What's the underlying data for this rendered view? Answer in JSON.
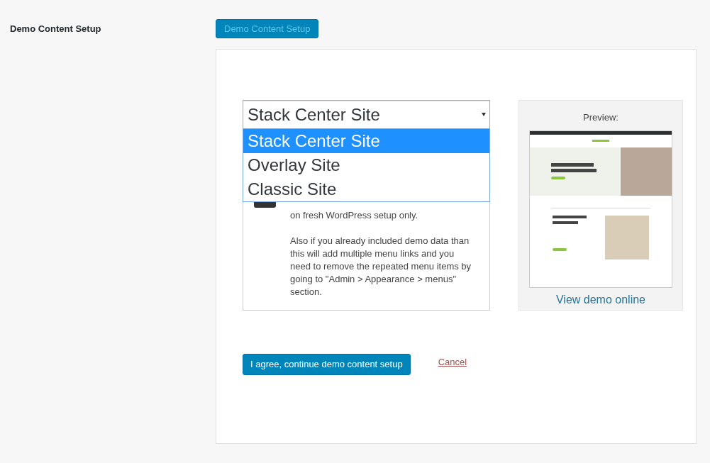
{
  "setting_label": "Demo Content Setup",
  "toggle_button": "Demo Content Setup",
  "site_select": {
    "value": "Stack Center Site",
    "expanded": true,
    "options": [
      {
        "label": "Stack Center Site",
        "selected": true
      },
      {
        "label": "Overlay Site",
        "selected": false
      },
      {
        "label": "Classic Site",
        "selected": false
      }
    ]
  },
  "notice": {
    "paragraphs": [
      "on fresh WordPress setup only.",
      "Also if you already included demo data than this will add multiple menu links and you need to remove the repeated menu items by going to \"Admin > Appearance > menus\" section."
    ]
  },
  "preview": {
    "title": "Preview:",
    "link": "View demo online"
  },
  "agree_button": "I agree, continue demo content setup",
  "cancel_link": "Cancel"
}
